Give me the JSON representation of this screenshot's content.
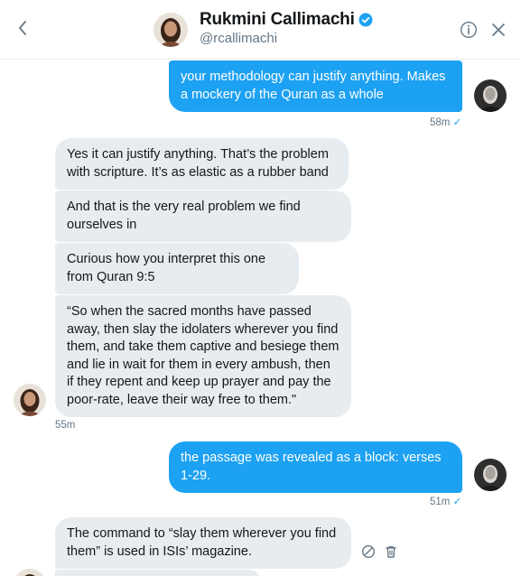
{
  "header": {
    "name": "Rukmini Callimachi",
    "handle": "@rcallimachi"
  },
  "messages": [
    {
      "text": "your methodology can justify anything. Makes a mockery of the Quran as a whole"
    },
    {
      "text": "Yes it can justify anything. That’s the problem with scripture. It’s as elastic as a rubber band"
    },
    {
      "text": "And that is the very real problem we find ourselves in"
    },
    {
      "text": "Curious how you interpret this one from Quran 9:5"
    },
    {
      "text": "“So when the sacred months have passed away, then slay the idolaters wherever you find them, and take them captive and besiege them and lie in wait for them in every ambush, then if they repent and keep up prayer and pay the poor-rate, leave their way free to them.\""
    },
    {
      "text": "the passage was revealed as a block: verses 1-29."
    },
    {
      "text": "The command to “slay them wherever you find them” is used in ISIs’ magazine."
    }
  ],
  "meta": {
    "time_1": "58m",
    "time_2": "55m",
    "time_3": "51m",
    "read_check": "✓"
  },
  "colors": {
    "accent": "#1da1f2",
    "incoming_bubble": "#e6ecf0",
    "secondary_text": "#657786"
  },
  "icons": [
    "back-arrow-icon",
    "verified-icon",
    "info-icon",
    "close-icon",
    "block-icon",
    "trash-icon"
  ]
}
